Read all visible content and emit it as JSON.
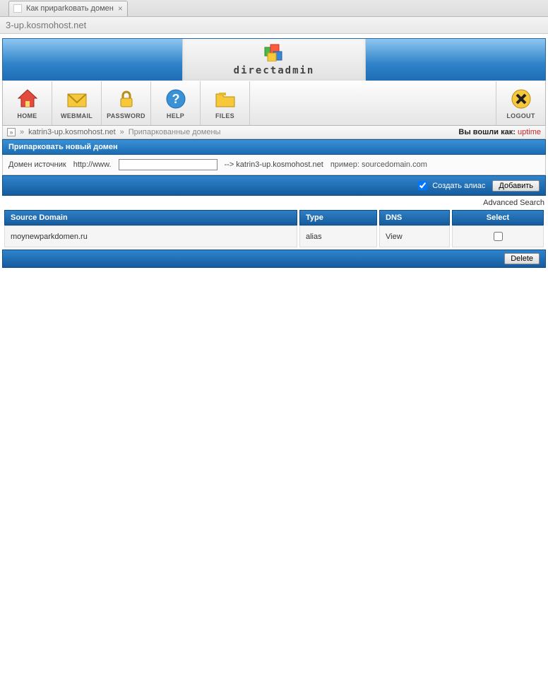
{
  "browser": {
    "tab_title": "Как приparkовать домен",
    "url": "3-up.kosmohost.net"
  },
  "logo_text": "directadmin",
  "toolbar": {
    "home": "HOME",
    "webmail": "WEBMAIL",
    "password": "PASSWORD",
    "help": "HELP",
    "files": "FILES",
    "logout": "LOGOUT"
  },
  "breadcrumb": {
    "domain": "katrin3-up.kosmohost.net",
    "section": "Припаркованные домены",
    "logged_label": "Вы вошли как:",
    "user": "uptime"
  },
  "park": {
    "title": "Припарковать новый домен",
    "source_label": "Домен источник",
    "prefix": "http://www.",
    "suffix": "--> katrin3-up.kosmohost.net",
    "example": "пример: sourcedomain.com",
    "alias_label": "Создать алиас",
    "add_button": "Добавить"
  },
  "adv_search": "Advanced Search",
  "table": {
    "headers": {
      "source": "Source Domain",
      "type": "Type",
      "dns": "DNS",
      "select": "Select"
    },
    "rows": [
      {
        "source": "moynewparkdomen.ru",
        "type": "alias",
        "dns": "View",
        "selected": false
      }
    ],
    "delete_button": "Delete"
  }
}
